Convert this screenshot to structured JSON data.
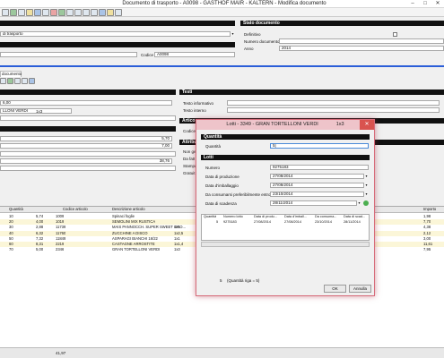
{
  "window": {
    "title": "Documento di trasporto - A0098 - GASTHOF MAIR - KALTERN - Modifica documento",
    "controls": [
      "–",
      "□",
      "✕"
    ]
  },
  "header": {
    "left_combo_value": "di trasporto",
    "codice_cliente_label": "Codice cliente",
    "codice_cliente_value": "A0098"
  },
  "stato_documento": {
    "section_title": "Stato documento",
    "definitivo_label": "Definitivo",
    "numero_documento_label": "Numero documento",
    "anno_label": "Anno",
    "anno_value": "2014"
  },
  "tab": {
    "label": "documento"
  },
  "detail": {
    "article_value": "LLONI VERDI",
    "article_qty": "1x3",
    "value_1": "6,00",
    "value_2": "5,70",
    "value_3": "7,00",
    "value_4": "38,76"
  },
  "testi": {
    "section_title": "Testi",
    "testo_informativo_label": "Testo informativo",
    "testo_interno_label": "Testo interno"
  },
  "left_labels": {
    "articolo_partial": "Artico",
    "codice_partial": "Codice",
    "attributi_partial": "Attribu",
    "non_ge_partial": "Non ge",
    "da_fatt_partial": "Da fatt",
    "stampa_partial": "Stampa",
    "gratuit_partial": "Gratuit"
  },
  "grid": {
    "columns": [
      "Quantità",
      "Codice articolo",
      "Descrizione articolo",
      "Importo"
    ],
    "rows": [
      {
        "qty": "10",
        "price": "5,74",
        "code": "1009",
        "desc": "Spinaci foglie",
        "extra": "",
        "importo": "1,98"
      },
      {
        "qty": "20",
        "price": "4,00",
        "code": "1019",
        "desc": "SEMOLINI MIX RUSTICA",
        "extra": "",
        "importo": "7,70"
      },
      {
        "qty": "30",
        "price": "2,88",
        "code": "11739",
        "desc": "MAIS PANNOCCH. SUPER SWEET GRO...",
        "extra": "1x1",
        "importo": "4,38"
      },
      {
        "qty": "40",
        "price": "6,32",
        "code": "11760",
        "desc": "ZUCCHINE A DISCO",
        "extra": "1x2,5",
        "importo": "2,12"
      },
      {
        "qty": "50",
        "price": "7,32",
        "code": "11849",
        "desc": "ASPARAGI BIANCHI 16/22",
        "extra": "1x1",
        "importo": "3,00"
      },
      {
        "qty": "60",
        "price": "8,31",
        "code": "2219",
        "desc": "CASTAGNE ARROSTITE",
        "extra": "1x1,4",
        "importo": "11,61"
      },
      {
        "qty": "70",
        "price": "5,00",
        "code": "2346",
        "desc": "GRAN TORTELLONI VERDI",
        "extra": "1x3",
        "importo": "7,95"
      }
    ]
  },
  "status": {
    "total": "41,97"
  },
  "modal": {
    "title": "Lotti - 3349 - GRAN TORTELLONI VERDI",
    "title_qty": "1x3",
    "quantita_section": "Quantità",
    "quantita_label": "Quantità",
    "quantita_value": "5",
    "lotti_section": "Lotti",
    "numero_label": "Numero",
    "numero_value": "9275183",
    "data_produzione_label": "Data di produzione",
    "data_produzione_value": "27/08/2014",
    "data_imballaggio_label": "Data d'imballaggio",
    "data_imballaggio_value": "27/08/2014",
    "data_consumare_label": "Da consumarsi preferibilmente entro",
    "data_consumare_value": "23/10/2014",
    "data_scadenza_label": "Data di scadenza",
    "data_scadenza_value": "28/11/2014",
    "grid_columns": [
      "Quantità",
      "Numero lotto",
      "Data di produ...",
      "Data d'imball...",
      "Da consuma...",
      "Data di scad..."
    ],
    "grid_row": {
      "qty": "5",
      "lotto": "9275183",
      "prod": "27/08/2014",
      "imball": "27/08/2014",
      "consumare": "23/10/2014",
      "scadenza": "28/11/2014"
    },
    "footer_qty": "5",
    "footer_text": "(Quantità riga = 5)",
    "ok_label": "OK",
    "cancel_label": "Annulla",
    "close_glyph": "✕"
  }
}
